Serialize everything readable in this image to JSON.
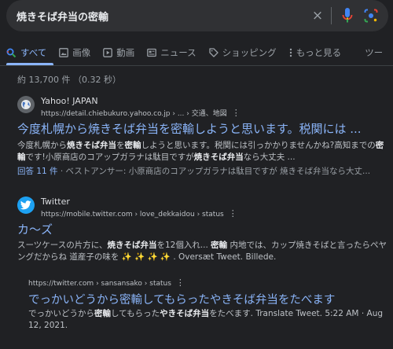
{
  "search": {
    "query": "焼きそば弁当の密輸",
    "clear_label": "×"
  },
  "tabs": [
    {
      "label": "すべて",
      "icon": "search-icon"
    },
    {
      "label": "画像",
      "icon": "image-icon"
    },
    {
      "label": "動画",
      "icon": "video-icon"
    },
    {
      "label": "ニュース",
      "icon": "news-icon"
    },
    {
      "label": "ショッピング",
      "icon": "tag-icon"
    },
    {
      "label": "もっと見る",
      "icon": "more-icon"
    },
    {
      "label": "ツー"
    }
  ],
  "result_stats": "約 13,700 件 （0.32 秒）",
  "results": [
    {
      "site_name": "Yahoo! JAPAN",
      "url": "https://detail.chiebukuro.yahoo.co.jp › ... › 交通、地図",
      "title": "今度札幌から焼きそば弁当を密輸しようと思います。税関には ...",
      "snippet": [
        {
          "t": "今度札幌から"
        },
        {
          "t": "焼きそば弁当",
          "b": true
        },
        {
          "t": "を"
        },
        {
          "t": "密輸",
          "b": true
        },
        {
          "t": "しようと思います。税関には引っかかりませんかね?高知までの"
        },
        {
          "t": "密輸",
          "b": true
        },
        {
          "t": "です!小原商店のコアップガラナは駄目ですが"
        },
        {
          "t": "焼きそば弁当",
          "b": true
        },
        {
          "t": "なら大丈夫 ..."
        }
      ],
      "answers": "回答 11 件",
      "best_answer": " · ベストアンサー: 小原商店のコアップガラナは駄目ですが 焼きそば弁当なら大丈..."
    },
    {
      "site_name": "Twitter",
      "url": "https://mobile.twitter.com › love_dekkaidou › status",
      "title": "カ～ズ",
      "snippet": [
        {
          "t": "スーツケースの片方に、"
        },
        {
          "t": "焼きそば弁当",
          "b": true
        },
        {
          "t": "を12個入れ... "
        },
        {
          "t": "密輸",
          "b": true
        },
        {
          "t": " 内地では、カップ焼きそばと言ったらペヤングだからね 道産子の味を ✨ ✨ ✨ ✨ . Oversæt Tweet. Billede."
        }
      ]
    },
    {
      "url": "https://twitter.com › sansansako › status",
      "title": "でっかいどうから密輸してもらったやきそば弁当をたべます",
      "snippet": [
        {
          "t": "でっかいどうから"
        },
        {
          "t": "密輸",
          "b": true
        },
        {
          "t": "してもらった"
        },
        {
          "t": "やきそば弁当",
          "b": true
        },
        {
          "t": "をたべます. Translate Tweet. 5:22 AM · Aug 12, 2021."
        }
      ]
    }
  ],
  "colors": {
    "background": "#202124",
    "link": "#8ab4f8",
    "text": "#bdc1c6"
  }
}
